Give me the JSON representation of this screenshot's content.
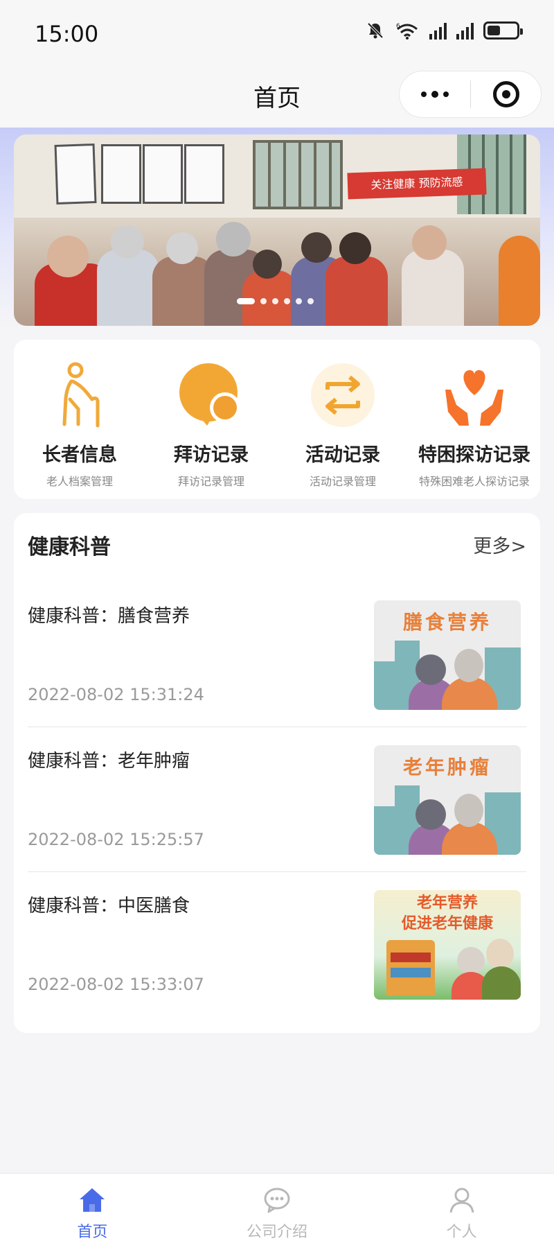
{
  "status_bar": {
    "time": "15:00",
    "wifi_label": "6",
    "battery_level": 0.45
  },
  "nav": {
    "title": "首页",
    "capsule_more_icon": "more-dots-icon",
    "capsule_close_icon": "target-close-icon"
  },
  "banner": {
    "sign_text": "关注健康 预防流感",
    "slide_count": 6,
    "active_slide": 1
  },
  "quick_menu": [
    {
      "title": "长者信息",
      "subtitle": "老人档案管理",
      "icon": "elderly-cane-icon",
      "color": "#f0a93a"
    },
    {
      "title": "拜访记录",
      "subtitle": "拜访记录管理",
      "icon": "visit-bubble-icon",
      "color": "#f2a735"
    },
    {
      "title": "活动记录",
      "subtitle": "活动记录管理",
      "icon": "refresh-arrows-icon",
      "color": "#f1a52f"
    },
    {
      "title": "特困探访记录",
      "subtitle": "特殊困难老人探访记录",
      "icon": "heart-hands-icon",
      "color": "#f5732a"
    }
  ],
  "health": {
    "title": "健康科普",
    "more": "更多>",
    "articles": [
      {
        "title": "健康科普：膳食营养",
        "time": "2022-08-02 15:31:24",
        "thumb_text": "膳食营养"
      },
      {
        "title": "健康科普：老年肿瘤",
        "time": "2022-08-02 15:25:57",
        "thumb_text": "老年肿瘤"
      },
      {
        "title": "健康科普：中医膳食",
        "time": "2022-08-02 15:33:07",
        "thumb_line1": "老年营养",
        "thumb_line2": "促进老年健康"
      }
    ]
  },
  "tab_bar": {
    "active_color": "#4a6be8",
    "inactive_color": "#b8b8b8",
    "tabs": [
      {
        "label": "首页",
        "icon": "home-icon",
        "active": true
      },
      {
        "label": "公司介绍",
        "icon": "chat-bubble-icon",
        "active": false
      },
      {
        "label": "个人",
        "icon": "person-icon",
        "active": false
      }
    ]
  }
}
